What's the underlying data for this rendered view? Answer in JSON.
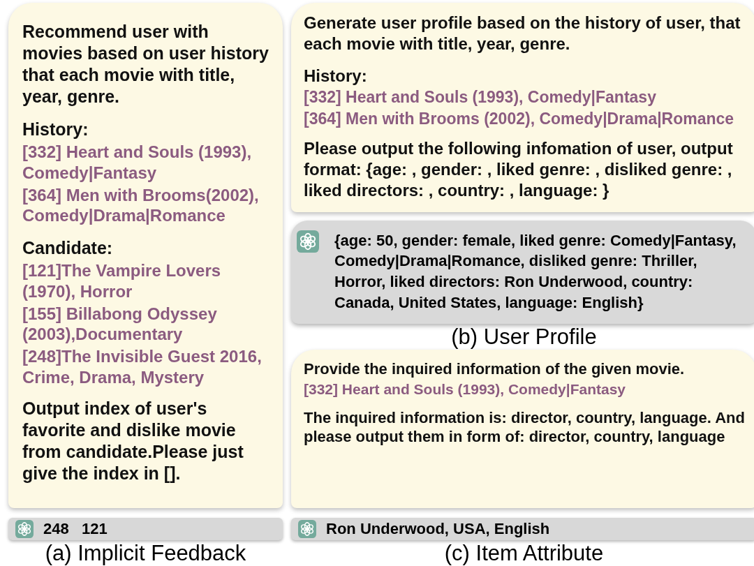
{
  "panels": [
    {
      "prompt": {
        "blocks": [
          {
            "kind": "text",
            "text": "Recommend user with movies based on user history  that each movie with title, year, genre."
          },
          {
            "kind": "heading",
            "text": "History:"
          },
          {
            "kind": "item",
            "text": "[332] Heart and Souls (1993), Comedy|Fantasy"
          },
          {
            "kind": "item",
            "text": "[364] Men with Brooms(2002), Comedy|Drama|Romance"
          },
          {
            "kind": "heading",
            "text": "Candidate:"
          },
          {
            "kind": "item",
            "text": "[121]The Vampire Lovers (1970), Horror"
          },
          {
            "kind": "item",
            "text": "[155] Billabong Odyssey (2003),Documentary"
          },
          {
            "kind": "item",
            "text": "[248]The Invisible Guest 2016, Crime, Drama, Mystery"
          },
          {
            "kind": "text",
            "text": "Output index of user's favorite and dislike movie from candidate.Please just give the index in []."
          }
        ]
      },
      "responses": [
        {
          "kind": "bar",
          "text": "248   121"
        }
      ],
      "caption": "(a)  Implicit Feedback"
    },
    {
      "prompt": {
        "blocks": [
          {
            "kind": "text",
            "text": "Generate user profile based on the history of user, that each movie with title, year, genre."
          },
          {
            "kind": "heading",
            "text": "History:"
          },
          {
            "kind": "item",
            "text": "[332] Heart and Souls (1993), Comedy|Fantasy"
          },
          {
            "kind": "item",
            "text": "[364] Men with Brooms (2002), Comedy|Drama|Romance"
          },
          {
            "kind": "text",
            "text": "Please output the following infomation of user, output format: {age: , gender: , liked genre: , disliked genre: , liked directors: , country: , language: }"
          }
        ]
      },
      "responses": [
        {
          "kind": "bubble",
          "text": "{age: 50, gender: female, liked genre: Comedy|Fantasy, Comedy|Drama|Romance, disliked genre: Thriller, Horror, liked directors: Ron Underwood, country: Canada, United States, language: English}"
        }
      ],
      "caption": "(b)  User Profile"
    },
    {
      "prompt": {
        "blocks": [
          {
            "kind": "text",
            "text": "Provide the inquired information of the given movie."
          },
          {
            "kind": "item",
            "text": "[332] Heart and Souls (1993), Comedy|Fantasy"
          },
          {
            "kind": "text",
            "text": "The inquired information is: director, country, language. And please output them in form of: director, country, language"
          }
        ]
      },
      "responses": [
        {
          "kind": "bar",
          "text": "Ron Underwood, USA, English"
        }
      ],
      "caption": "(c)  Item Attribute"
    }
  ]
}
